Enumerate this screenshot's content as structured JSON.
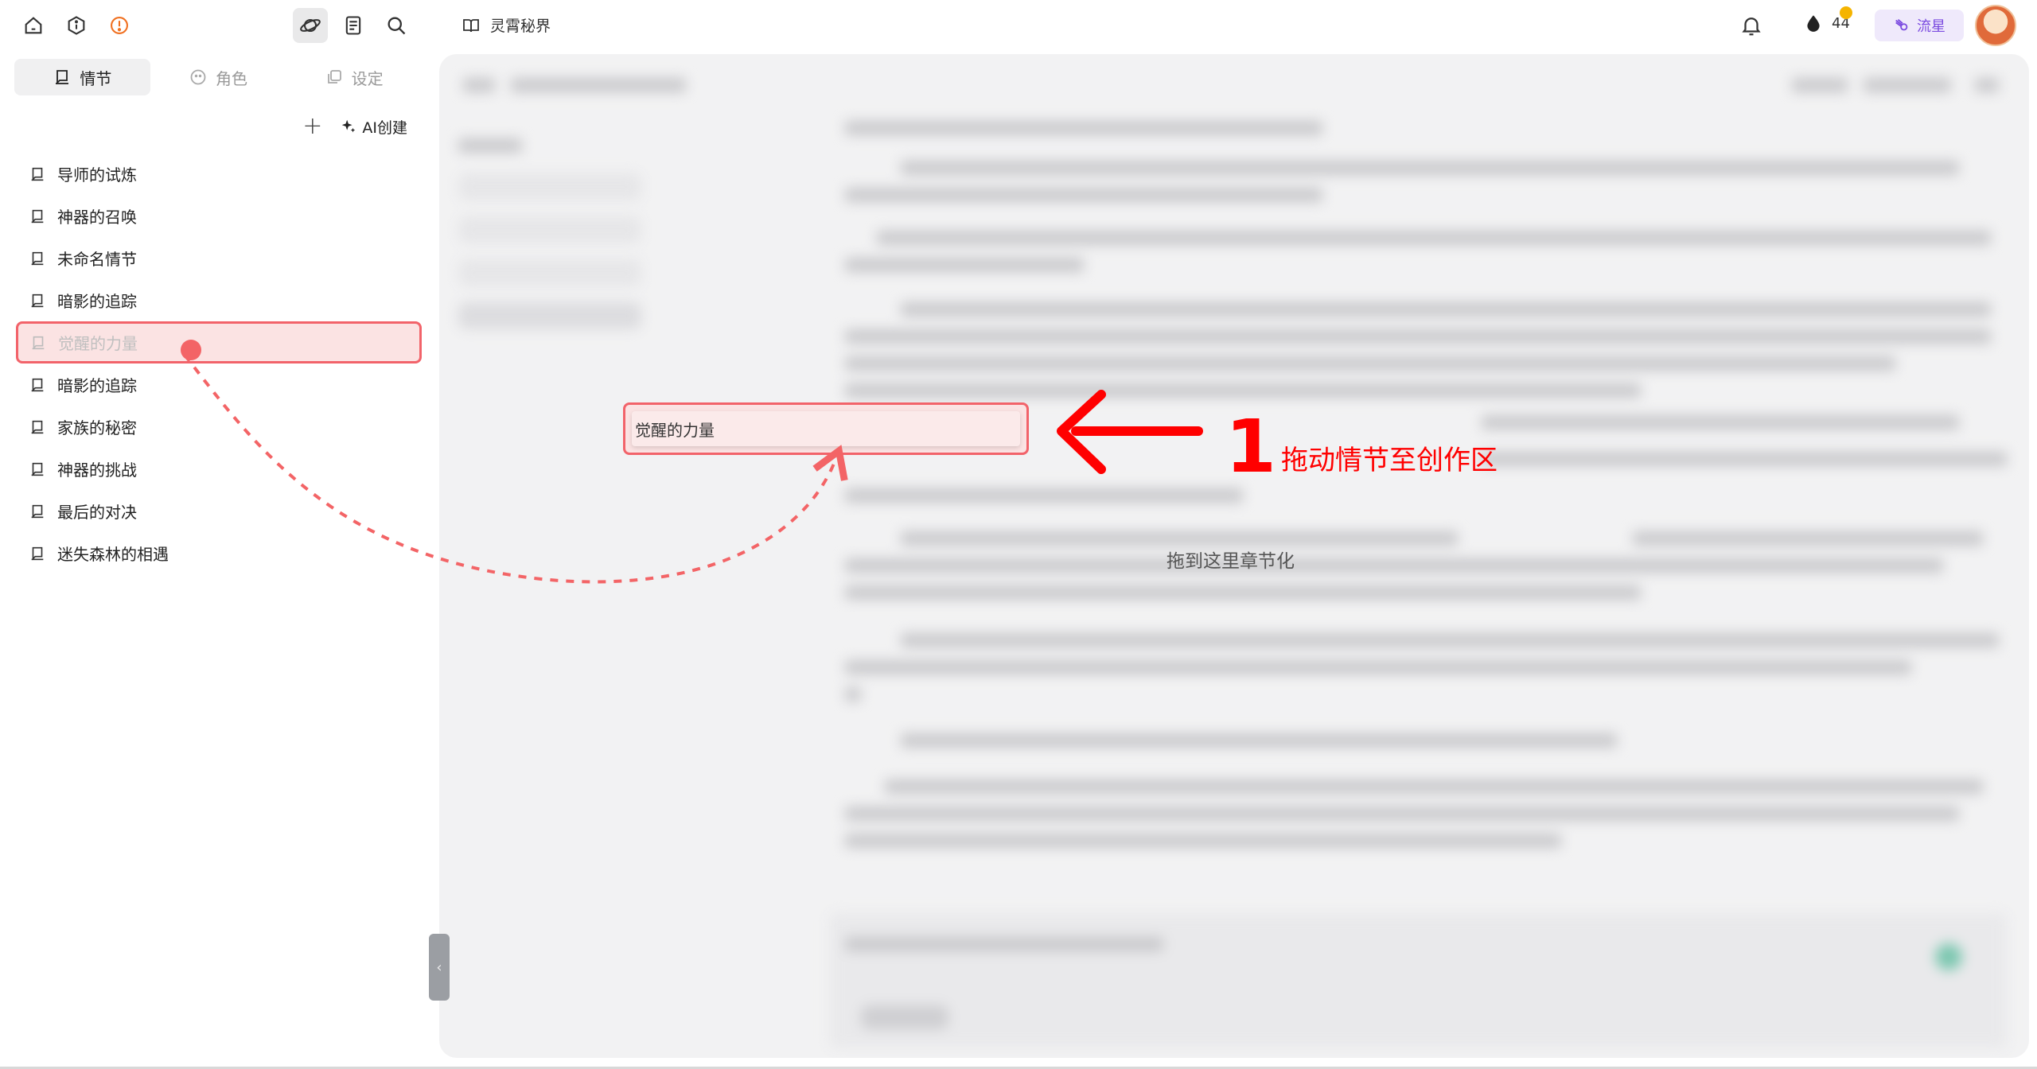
{
  "sidebar": {
    "tabs": [
      {
        "label": "情节",
        "active": true
      },
      {
        "label": "角色",
        "active": false
      },
      {
        "label": "设定",
        "active": false
      }
    ],
    "ai_create_label": "AI创建",
    "plots": [
      {
        "label": "导师的试炼"
      },
      {
        "label": "神器的召唤"
      },
      {
        "label": "未命名情节"
      },
      {
        "label": "暗影的追踪"
      },
      {
        "label": "觉醒的力量",
        "dragging": true
      },
      {
        "label": "暗影的追踪"
      },
      {
        "label": "家族的秘密"
      },
      {
        "label": "神器的挑战"
      },
      {
        "label": "最后的对决"
      },
      {
        "label": "迷失森林的相遇"
      }
    ]
  },
  "header": {
    "book_title": "灵霄秘界",
    "ink_count": "44",
    "member_label": "流星"
  },
  "editor": {
    "drop_hint": "拖到这里章节化"
  },
  "drag_preview": {
    "label": "觉醒的力量"
  },
  "annotation": {
    "number": "1",
    "text": "拖动情节至创作区"
  },
  "colors": {
    "accent_red": "#f2636a",
    "annotation_red": "#ff0000",
    "member_purple": "#7b4be0",
    "badge_yellow": "#f5b400"
  }
}
